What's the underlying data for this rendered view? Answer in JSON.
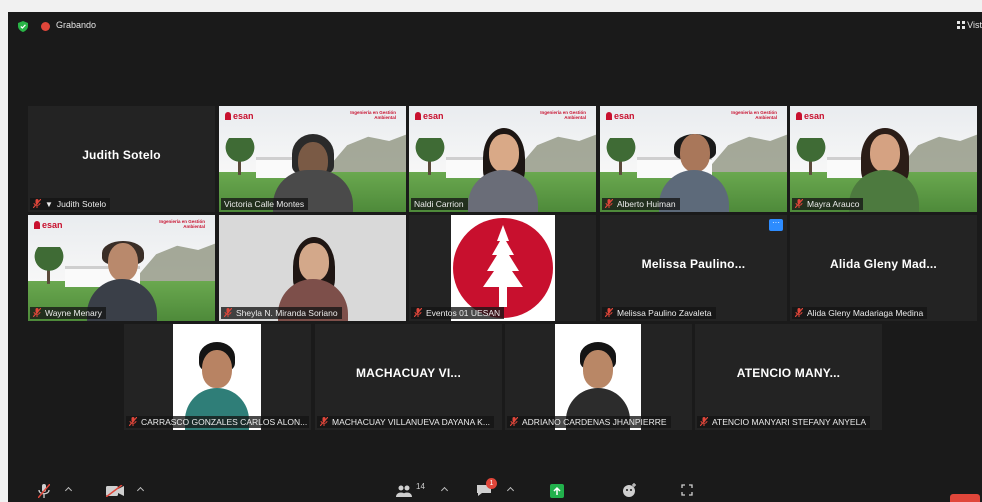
{
  "topbar": {
    "recording_label": "Grabando",
    "view_label": "Vist"
  },
  "participants": [
    {
      "name_label": "Judith Sotelo",
      "display_name": "Judith Sotelo",
      "pinned": true
    },
    {
      "name_label": "Victoria Calle Montes"
    },
    {
      "name_label": "Naldi Carrion",
      "active_speaker": true
    },
    {
      "name_label": "Alberto Huiman"
    },
    {
      "name_label": "Mayra Arauco"
    },
    {
      "name_label": "Wayne Menary"
    },
    {
      "name_label": "Sheyla N. Miranda Soriano"
    },
    {
      "name_label": "Eventos 01 UESAN"
    },
    {
      "name_label": "Melissa Paulino Zavaleta",
      "display_name": "Melissa  Paulino..."
    },
    {
      "name_label": "Alida Gleny Madariaga Medina",
      "display_name": "Alida Gleny Mad..."
    },
    {
      "name_label": "CARRASCO GONZALES CARLOS ALON..."
    },
    {
      "name_label": "MACHACUAY VILLANUEVA DAYANA K...",
      "display_name": "MACHACUAY  VI..."
    },
    {
      "name_label": "ADRIANO CARDENAS JHANPIERRE"
    },
    {
      "name_label": "ATENCIO MANYARI STEFANY ANYELA",
      "display_name": "ATENCIO  MANY..."
    }
  ],
  "virtual_background": {
    "brand": "esan",
    "program": "Ingeniería en Gestión Ambiental"
  },
  "more_button_label": "···",
  "toolbar": {
    "participants_count": "14",
    "chat_badge": "1"
  },
  "colors": {
    "background": "#1a1a1a",
    "tile": "#232323",
    "active_speaker": "#a3e04a",
    "muted_icon": "#e0463a",
    "brand_red": "#c8102e",
    "accent_blue": "#2d8cff"
  }
}
